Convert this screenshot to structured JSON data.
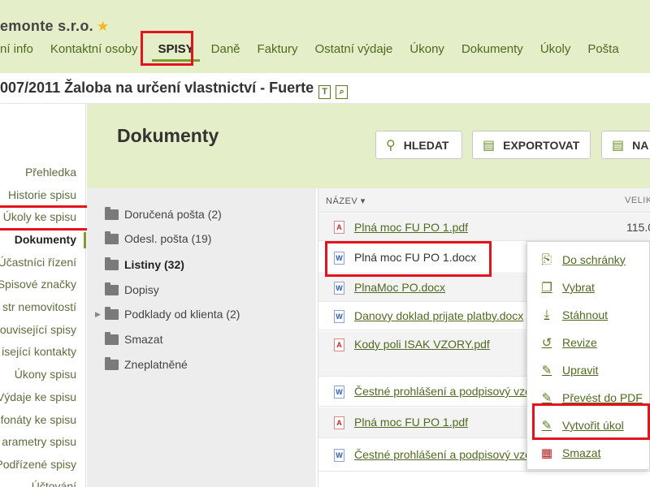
{
  "header": {
    "company": "emonte s.r.o.",
    "nav": [
      "ní info",
      "Kontaktní osoby",
      "SPISY",
      "Daně",
      "Faktury",
      "Ostatní výdaje",
      "Úkony",
      "Dokumenty",
      "Úkoly",
      "Pošta"
    ],
    "case_title": "007/2011 Žaloba na určení vlastnictví - Fuerte"
  },
  "sidebar": {
    "items": [
      "Přehledka",
      "Historie spisu",
      "Úkoly ke spisu",
      "Dokumenty",
      "Účastníci řízení",
      "Spisové značky",
      "str nemovitostí",
      "ouvisející spisy",
      "isející kontakty",
      "Úkony spisu",
      "Výdaje ke spisu",
      "fonáty ke spisu",
      "arametry spisu",
      "Podřízené spisy",
      "Účtování"
    ]
  },
  "content": {
    "title": "Dokumenty",
    "buttons": [
      "HLEDAT",
      "EXPORTOVAT",
      "NA"
    ]
  },
  "folders": [
    {
      "label": "Doručená pošta (2)",
      "bold": false
    },
    {
      "label": "Odesl. pošta (19)",
      "bold": false
    },
    {
      "label": "Listiny (32)",
      "bold": true
    },
    {
      "label": "Dopisy",
      "bold": false
    },
    {
      "label": "Podklady od klienta (2)",
      "bold": false,
      "expandable": true
    },
    {
      "label": "Smazat",
      "bold": false
    },
    {
      "label": "Zneplatněné",
      "bold": false
    }
  ],
  "files": {
    "col_name": "NÁZEV ▾",
    "col_size": "VELIK",
    "rows": [
      {
        "name": "Plná moc FU PO 1.pdf",
        "type": "pdf",
        "size": "115.0"
      },
      {
        "name": "Plná moc FU PO 1.docx",
        "type": "doc",
        "size": ""
      },
      {
        "name": "PlnaMoc PO.docx",
        "type": "doc",
        "size": ""
      },
      {
        "name": "Danovy doklad prijate platby.docx",
        "type": "doc",
        "size": ""
      },
      {
        "name": "Kody poli ISAK VZORY.pdf",
        "type": "pdf",
        "size": ""
      },
      {
        "name": "Čestné prohlášení a podpisový vzor",
        "type": "doc",
        "size": ""
      },
      {
        "name": "Plná moc FU PO 1.pdf",
        "type": "pdf",
        "size": ""
      },
      {
        "name": "Čestné prohlášení a podpisový vzor",
        "type": "doc",
        "size": ""
      }
    ]
  },
  "context_menu": [
    {
      "label": "Do schránky",
      "icon": "clipboard-icon"
    },
    {
      "label": "Vybrat",
      "icon": "select-icon"
    },
    {
      "label": "Stáhnout",
      "icon": "download-icon"
    },
    {
      "label": "Revize",
      "icon": "history-icon"
    },
    {
      "label": "Upravit",
      "icon": "pencil-icon"
    },
    {
      "label": "Převést do PDF",
      "icon": "pencil-icon"
    },
    {
      "label": "Vytvořit úkol",
      "icon": "pencil-icon"
    },
    {
      "label": "Smazat",
      "icon": "trash-icon"
    }
  ]
}
